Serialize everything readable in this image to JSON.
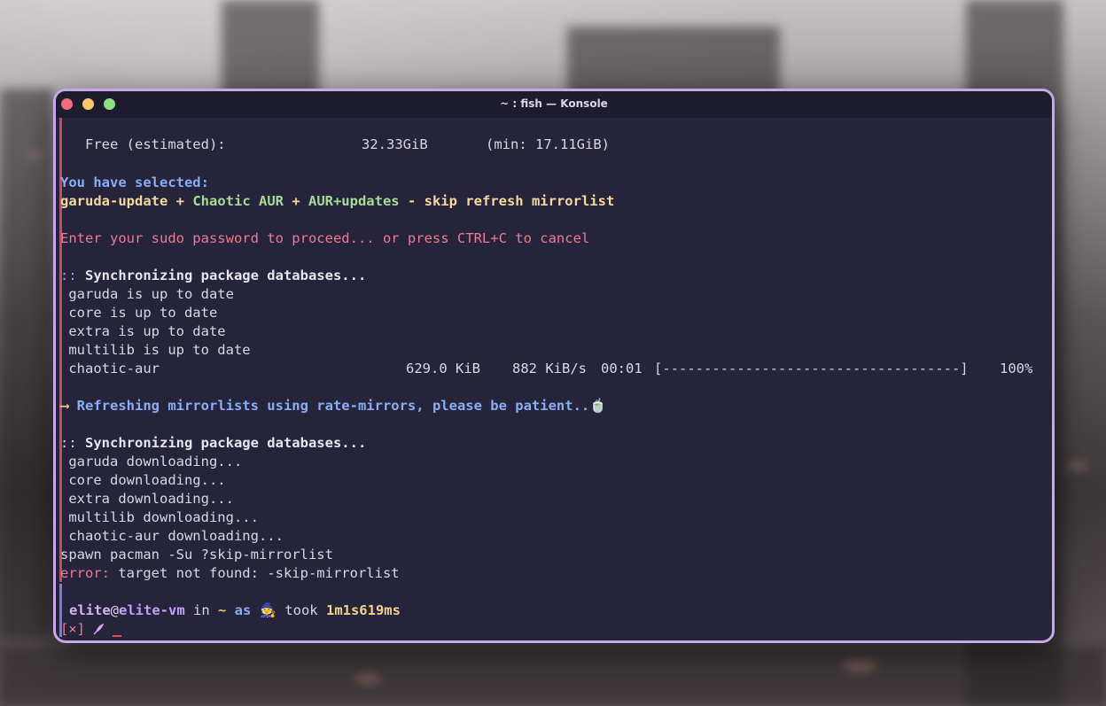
{
  "window": {
    "title": "~ : fish — Konsole"
  },
  "terminal": {
    "free_label": "   Free (estimated):",
    "free_value": "32.33GiB",
    "free_min": "(min: 17.11GiB)",
    "selected_label": "You have selected:",
    "sel_1": "garuda-update",
    "sel_plus1": " + ",
    "sel_2": "Chaotic AUR",
    "sel_plus2": " + ",
    "sel_3": "AUR+updates",
    "sel_dash": " - ",
    "sel_4": "skip refresh mirrorlist",
    "sudo_prompt": "Enter your sudo password to proceed... or press CTRL+C to cancel",
    "sync1_prefix": "::",
    "sync1_text": " Synchronizing package databases...",
    "db_lines_1": [
      " garuda is up to date",
      " core is up to date",
      " extra is up to date",
      " multilib is up to date"
    ],
    "chaotic_name": " chaotic-aur",
    "chaotic_size": "629.0 KiB",
    "chaotic_speed": "882 KiB/s",
    "chaotic_time": "00:01",
    "chaotic_bar": "[------------------------------------]",
    "chaotic_pct": "100%",
    "arrow": "⟶",
    "refresh_text": " Refreshing mirrorlists using rate-mirrors, please be patient..",
    "refresh_emoji": "🍵",
    "sync2_prefix": "::",
    "sync2_text": " Synchronizing package databases...",
    "db_lines_2": [
      " garuda downloading...",
      " core downloading...",
      " extra downloading...",
      " multilib downloading...",
      " chaotic-aur downloading..."
    ],
    "spawn_line": "spawn pacman -Su ?skip-mirrorlist",
    "error_label": "error:",
    "error_text": " target not found: -skip-mirrorlist",
    "prompt_user": "elite",
    "prompt_at": "@",
    "prompt_host": "elite-vm",
    "prompt_in": " in ",
    "prompt_dir": "~",
    "prompt_as": " as ",
    "prompt_emoji": "🧙",
    "prompt_took": " took ",
    "prompt_time": "1m1s619ms",
    "exit_status": "[×]"
  },
  "colors": {
    "border": "#c9a5ea",
    "background": "#25243a",
    "error": "#ee7b92",
    "accent_blue": "#8aadf4"
  },
  "icons": {
    "close": "close-dot-icon",
    "minimize": "minimize-dot-icon",
    "maximize": "maximize-dot-icon",
    "prompt": "feather-icon"
  }
}
